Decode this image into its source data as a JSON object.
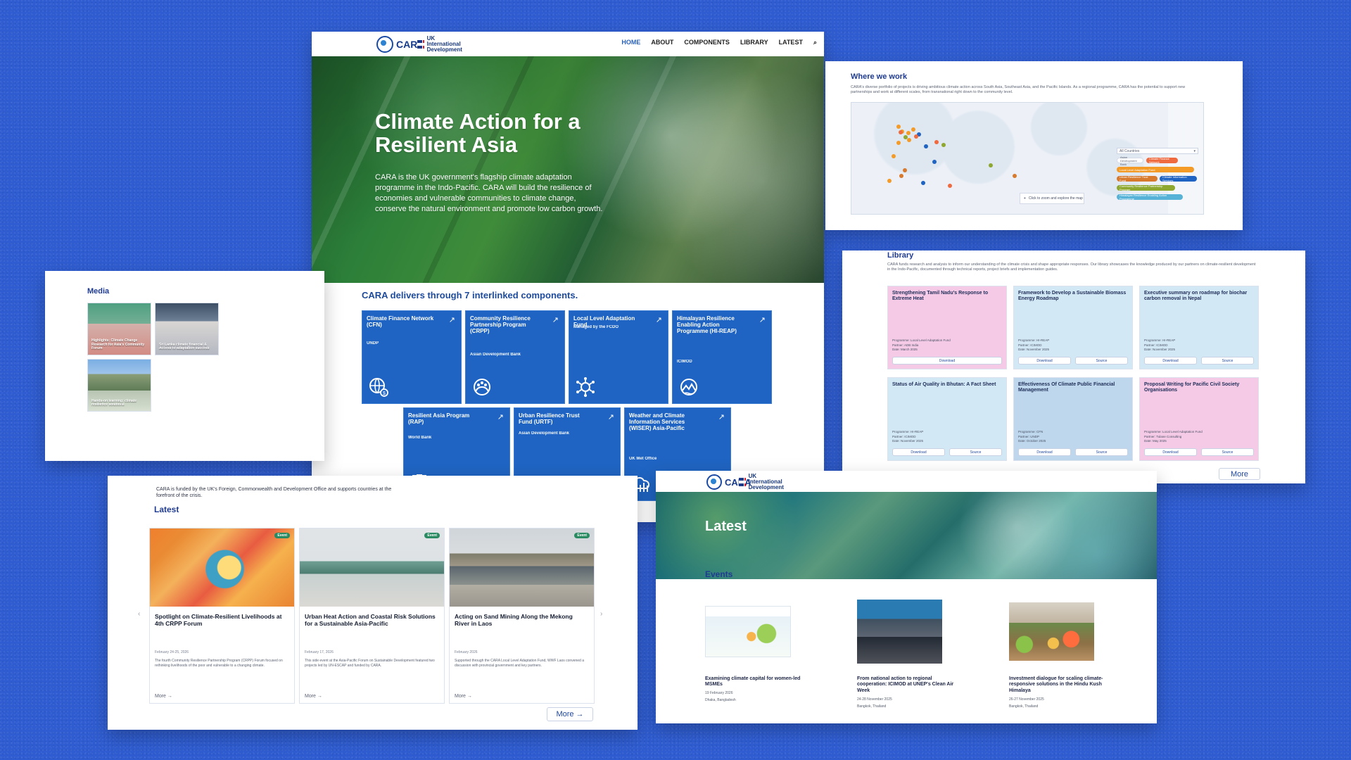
{
  "main": {
    "logo_text": "CARA",
    "ukid_text": "UK International Development",
    "menu": [
      "HOME",
      "ABOUT",
      "COMPONENTS",
      "LIBRARY",
      "LATEST"
    ],
    "hero_title": "Climate Action for a Resilient Asia",
    "hero_desc": "CARA is the UK government's flagship climate adaptation programme in the Indo-Pacific. CARA will build the resilience of economies and vulnerable communities to climate change, conserve the natural environment and promote low carbon growth.",
    "components_title": "CARA delivers through 7 interlinked components.",
    "components": [
      {
        "name": "Climate Finance Network (CFN)",
        "org": "UNDP"
      },
      {
        "name": "Community Resilience Partnership Program (CRPP)",
        "org": "Asian Development Bank"
      },
      {
        "name": "Local Level Adaptation Fund",
        "org": "Managed by the FCDO"
      },
      {
        "name": "Himalayan Resilience Enabling Action Programme (HI-REAP)",
        "org": "ICIMOD"
      },
      {
        "name": "Resilient Asia Program (RAP)",
        "org": "World Bank"
      },
      {
        "name": "Urban Resilience Trust Fund (URTF)",
        "org": "Asian Development Bank"
      },
      {
        "name": "Weather and Climate Information Services (WISER) Asia-Pacific",
        "org": "UK Met Office"
      }
    ]
  },
  "media": {
    "title": "Media",
    "items": [
      "Highlights: Climate Change Research for Asia's Community Forum",
      "Sri Lanka climate financial & Access to adaptation success",
      "Hands-on learning: climate resilience solutions"
    ]
  },
  "where": {
    "title": "Where we work",
    "desc": "CARA's diverse portfolio of projects is driving ambitious climate action across South Asia, Southeast Asia, and the Pacific Islands. As a regional programme, CARA has the potential to support new partnerships and work at different scales, from transnational right down to the community level.",
    "dropdown": "All Countries",
    "tooltip": "Click to zoom and explore the map",
    "legend": [
      "Asian Development Bank",
      "Climate Finance Network",
      "Local Level Adaptation Fund",
      "Urban Resilience Trust Fund",
      "Climate Information Services",
      "Community Resilience Partnership Program",
      "Himalayan Resilience Enabling Action Programme"
    ]
  },
  "library": {
    "title": "Library",
    "desc": "CARA funds research and analysis to inform our understanding of the climate crisis and shape appropriate responses. Our library showcases the knowledge produced by our partners on climate-resilient development in the Indo-Pacific, documented through technical reports, project briefs and implementation guides.",
    "cards": [
      {
        "title": "Strengthening Tamil Nadu's Response to Extreme Heat",
        "programme": "Local Level Adaptation Fund",
        "partner": "ADB India",
        "date": "March 2025",
        "action1": "Download",
        "action2": ""
      },
      {
        "title": "Framework to Develop a Sustainable Biomass Energy Roadmap",
        "programme": "HI-REAP",
        "partner": "ICIMOD",
        "date": "November 2025",
        "action1": "Download",
        "action2": "Source"
      },
      {
        "title": "Executive summary on roadmap for biochar carbon removal in Nepal",
        "programme": "HI-REAP",
        "partner": "ICIMOD",
        "date": "November 2025",
        "action1": "Download",
        "action2": "Source"
      },
      {
        "title": "Status of Air Quality in Bhutan: A Fact Sheet",
        "programme": "HI-REAP",
        "partner": "ICIMOD",
        "date": "November 2025",
        "action1": "Download",
        "action2": "Source"
      },
      {
        "title": "Effectiveness Of Climate Public Financial Management",
        "programme": "CFN",
        "partner": "UNDP",
        "date": "October 2025",
        "action1": "Download",
        "action2": "Source"
      },
      {
        "title": "Proposal Writing for Pacific Civil Society Organisations",
        "programme": "Local Level Adaptation Fund",
        "partner": "Tulane Consulting",
        "date": "May 2025",
        "action1": "Download",
        "action2": "Source"
      }
    ],
    "more_label": "More"
  },
  "latest_left": {
    "funded_by": "CARA is funded by the UK's Foreign, Commonwealth and Development Office and supports countries at the forefront of the crisis.",
    "title": "Latest",
    "articles": [
      {
        "badge": "Event",
        "title": "Spotlight on Climate-Resilient Livelihoods at 4th CRPP Forum",
        "date": "February 24-25, 2026",
        "summary": "The fourth Community Resilience Partnership Program (CRPP) Forum focused on rethinking livelihoods of the poor and vulnerable to a changing climate.",
        "more": "More →"
      },
      {
        "badge": "Event",
        "title": "Urban Heat Action and Coastal Risk Solutions for a Sustainable Asia-Pacific",
        "date": "February 17, 2026",
        "summary": "This side event at the Asia-Pacific Forum on Sustainable Development featured two projects led by UN-ESCAP and funded by CARA.",
        "more": "More →"
      },
      {
        "badge": "Event",
        "title": "Acting on Sand Mining Along the Mekong River in Laos",
        "date": "February 2026",
        "summary": "Supported through the CARA Local Level Adaptation Fund, WWF Laos convened a discussion with provincial government and key partners.",
        "more": "More →"
      }
    ],
    "more_button": "More →"
  },
  "events_panel": {
    "logo_text": "CARA",
    "ukid_text": "UK International Development",
    "banner_title": "Latest",
    "events_title": "Events",
    "events": [
      {
        "title": "Examining climate capital for women-led MSMEs",
        "date": "19 February 2026",
        "place": "Dhaka, Bangladesh"
      },
      {
        "title": "From national action to regional cooperation: ICIMOD at UNEP's Clean Air Week",
        "date": "24-28 November 2025",
        "place": "Bangkok, Thailand"
      },
      {
        "title": "Investment dialogue for scaling climate-responsive solutions in the Hindu Kush Himalaya",
        "date": "26-27 November 2025",
        "place": "Bangkok, Thailand"
      }
    ]
  }
}
